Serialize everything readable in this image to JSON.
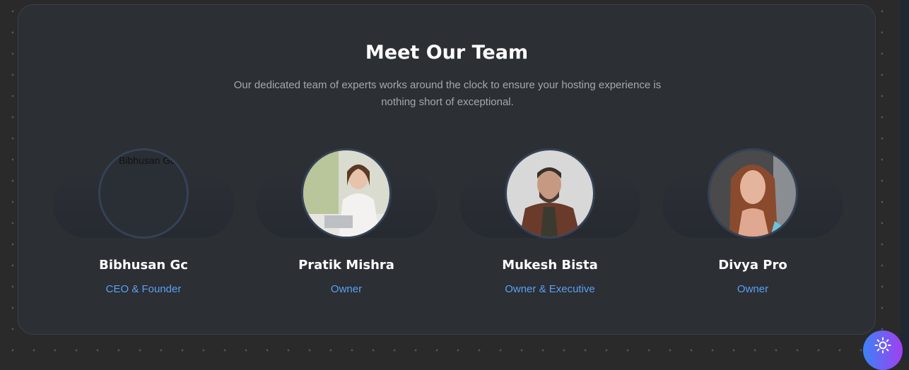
{
  "section": {
    "title": "Meet Our Team",
    "subtitle": "Our dedicated team of experts works around the clock to ensure your hosting experience is nothing short of exceptional."
  },
  "members": [
    {
      "name": "Bibhusan Gc",
      "role": "CEO & Founder",
      "image_alt": "Bibhusan Gc",
      "image_loaded": false
    },
    {
      "name": "Pratik Mishra",
      "role": "Owner",
      "image_loaded": true
    },
    {
      "name": "Mukesh Bista",
      "role": "Owner & Executive",
      "image_loaded": true
    },
    {
      "name": "Divya Pro",
      "role": "Owner",
      "image_loaded": true
    }
  ],
  "theme_toggle": {
    "icon": "sun-icon"
  },
  "colors": {
    "accent": "#5aa0f2",
    "title": "#ffffff",
    "toggle_gradient": [
      "#3b82f6",
      "#a23ff0"
    ]
  }
}
